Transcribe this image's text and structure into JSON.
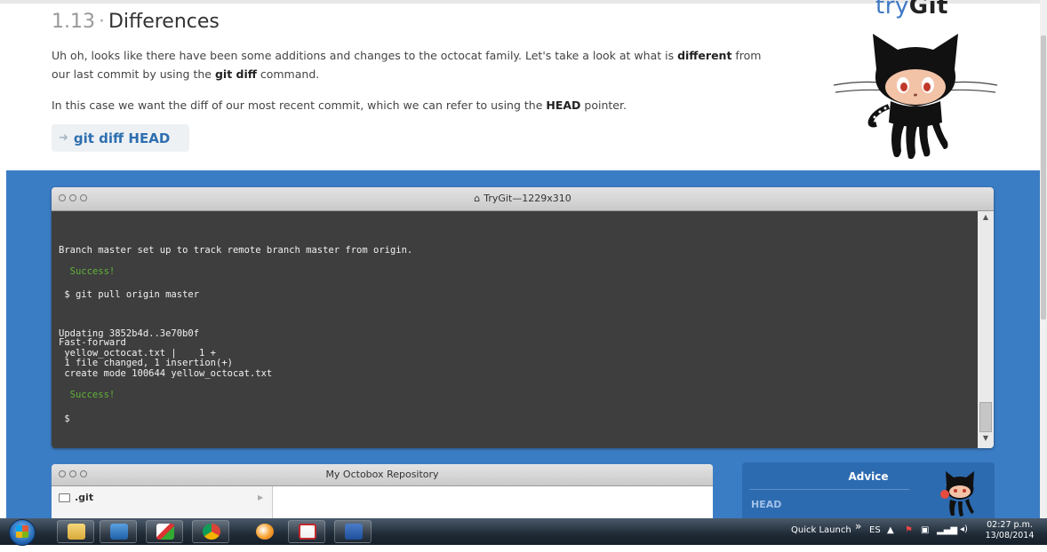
{
  "lesson": {
    "number": "1.13",
    "separator": "·",
    "title": "Differences",
    "p1_a": "Uh oh, looks like there have been some additions and changes to the octocat family. Let's take a look at what is ",
    "p1_b": "different",
    "p1_c": " from our last commit by using the ",
    "p1_d": "git diff",
    "p1_e": " command.",
    "p2_a": "In this case we want the diff of our most recent commit, which we can refer to using the ",
    "p2_b": "HEAD",
    "p2_c": " pointer.",
    "command": "git diff HEAD"
  },
  "logo": {
    "prefix": "try",
    "bold": "Git"
  },
  "terminal": {
    "title": "TryGit—1229x310",
    "lines": [
      {
        "text": "Branch master set up to track remote branch master from origin.",
        "kind": "out"
      },
      {
        "text": "  Success!",
        "kind": "ok"
      },
      {
        "text": " $ git pull origin master",
        "kind": "out"
      },
      {
        "text": "Updating 3852b4d..3e70b0f",
        "kind": "out"
      },
      {
        "text": "Fast-forward",
        "kind": "out"
      },
      {
        "text": " yellow_octocat.txt |    1 +",
        "kind": "out"
      },
      {
        "text": " 1 file changed, 1 insertion(+)",
        "kind": "out"
      },
      {
        "text": " create mode 100644 yellow_octocat.txt",
        "kind": "out"
      },
      {
        "text": "  Success!",
        "kind": "ok"
      },
      {
        "text": " $",
        "kind": "out"
      }
    ]
  },
  "repository": {
    "title": "My Octobox Repository",
    "item": ".git"
  },
  "advice": {
    "title": "Advice",
    "heading": "HEAD"
  },
  "taskbar": {
    "quick_launch": "Quick Launch",
    "chevron": "»",
    "lang": "ES",
    "time": "02:27 p.m.",
    "date": "13/08/2014",
    "icons": [
      "start-orb",
      "file-explorer-icon",
      "media-player-icon",
      "pen-app-icon",
      "chrome-icon",
      "blob-app-icon",
      "acrobat-icon",
      "word-icon"
    ]
  },
  "colors": {
    "accent_blue": "#3b7dc4",
    "link_blue": "#2e6fb0",
    "terminal_bg": "#3e3e3e",
    "success_green": "#61b33a"
  }
}
